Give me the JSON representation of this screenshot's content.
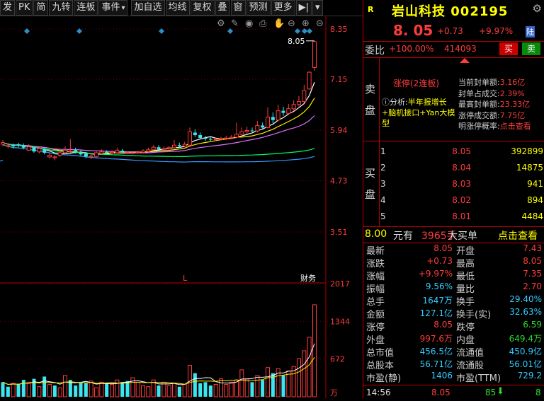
{
  "toolbar": {
    "buttons": [
      "发",
      "PK",
      "简",
      "九转",
      "连板",
      "事件",
      "加自选",
      "均线",
      "复权",
      "叠",
      "窗",
      "预测",
      "更多"
    ],
    "dropdown_button": "事件",
    "icons": [
      "jump-end-icon",
      "dropdown-icon"
    ]
  },
  "chart_tools": [
    "settings-icon",
    "pencil-icon",
    "eye-icon",
    "print-icon",
    "hand-icon",
    "zoom-out-icon",
    "zoom-in-icon",
    "collapse-icon"
  ],
  "price_axis": [
    "8.35",
    "7.15",
    "5.94",
    "4.73",
    "3.51"
  ],
  "volume_axis": [
    "2017",
    "1344",
    "672",
    "万"
  ],
  "last_price_label": "8.05",
  "chart_markers": {
    "low_label": "L",
    "finance_label": "财务"
  },
  "chart_data": {
    "type": "candlestick",
    "title": "",
    "ylim_price": [
      3.51,
      8.35
    ],
    "ylim_volume": [
      0,
      2017
    ],
    "candles": [
      {
        "o": 5.6,
        "c": 5.64,
        "h": 5.7,
        "l": 5.55
      },
      {
        "o": 5.55,
        "c": 5.57,
        "h": 5.63,
        "l": 5.5
      },
      {
        "o": 5.58,
        "c": 5.55,
        "h": 5.62,
        "l": 5.5
      },
      {
        "o": 5.6,
        "c": 5.58,
        "h": 5.64,
        "l": 5.53
      },
      {
        "o": 5.58,
        "c": 5.52,
        "h": 5.62,
        "l": 5.48
      },
      {
        "o": 5.46,
        "c": 5.54,
        "h": 5.6,
        "l": 5.44
      },
      {
        "o": 5.52,
        "c": 5.43,
        "h": 5.56,
        "l": 5.4
      },
      {
        "o": 5.42,
        "c": 5.5,
        "h": 5.54,
        "l": 5.38
      },
      {
        "o": 5.48,
        "c": 5.4,
        "h": 5.52,
        "l": 5.36
      },
      {
        "o": 5.3,
        "c": 5.34,
        "h": 5.4,
        "l": 5.26
      },
      {
        "o": 5.28,
        "c": 5.3,
        "h": 5.34,
        "l": 5.22
      },
      {
        "o": 5.34,
        "c": 5.4,
        "h": 5.5,
        "l": 5.3
      },
      {
        "o": 5.4,
        "c": 5.46,
        "h": 5.55,
        "l": 5.36
      },
      {
        "o": 5.44,
        "c": 5.44,
        "h": 5.72,
        "l": 5.4
      },
      {
        "o": 5.46,
        "c": 5.42,
        "h": 5.52,
        "l": 5.38
      },
      {
        "o": 5.4,
        "c": 5.36,
        "h": 5.46,
        "l": 5.32
      },
      {
        "o": 5.38,
        "c": 5.31,
        "h": 5.42,
        "l": 5.27
      },
      {
        "o": 5.3,
        "c": 5.32,
        "h": 5.4,
        "l": 5.25
      },
      {
        "o": 5.31,
        "c": 5.4,
        "h": 5.45,
        "l": 5.29
      },
      {
        "o": 5.38,
        "c": 5.42,
        "h": 5.48,
        "l": 5.35
      },
      {
        "o": 5.42,
        "c": 5.4,
        "h": 5.46,
        "l": 5.37
      },
      {
        "o": 5.39,
        "c": 5.41,
        "h": 5.46,
        "l": 5.36
      },
      {
        "o": 5.4,
        "c": 5.46,
        "h": 5.52,
        "l": 5.38
      },
      {
        "o": 5.45,
        "c": 5.41,
        "h": 5.49,
        "l": 5.38
      },
      {
        "o": 5.4,
        "c": 5.4,
        "h": 5.43,
        "l": 5.36
      },
      {
        "o": 5.39,
        "c": 5.4,
        "h": 5.44,
        "l": 5.36
      },
      {
        "o": 5.4,
        "c": 5.41,
        "h": 5.45,
        "l": 5.37
      },
      {
        "o": 5.41,
        "c": 5.44,
        "h": 5.48,
        "l": 5.38
      },
      {
        "o": 5.43,
        "c": 5.47,
        "h": 5.52,
        "l": 5.41
      },
      {
        "o": 5.47,
        "c": 5.53,
        "h": 5.58,
        "l": 5.45
      },
      {
        "o": 5.53,
        "c": 5.48,
        "h": 5.58,
        "l": 5.45
      },
      {
        "o": 5.48,
        "c": 5.5,
        "h": 5.55,
        "l": 5.46
      },
      {
        "o": 5.5,
        "c": 5.52,
        "h": 5.56,
        "l": 5.47
      },
      {
        "o": 5.52,
        "c": 5.58,
        "h": 5.7,
        "l": 5.5
      },
      {
        "o": 5.58,
        "c": 5.55,
        "h": 5.64,
        "l": 5.52
      },
      {
        "o": 5.56,
        "c": 5.6,
        "h": 5.66,
        "l": 5.53
      },
      {
        "o": 5.58,
        "c": 5.9,
        "h": 6.0,
        "l": 5.56
      },
      {
        "o": 5.88,
        "c": 5.82,
        "h": 5.96,
        "l": 5.78
      },
      {
        "o": 5.82,
        "c": 5.75,
        "h": 5.88,
        "l": 5.72
      },
      {
        "o": 5.75,
        "c": 5.73,
        "h": 5.8,
        "l": 5.68
      },
      {
        "o": 5.73,
        "c": 5.71,
        "h": 5.78,
        "l": 5.68
      },
      {
        "o": 5.72,
        "c": 5.73,
        "h": 5.76,
        "l": 5.68
      },
      {
        "o": 5.72,
        "c": 5.74,
        "h": 5.78,
        "l": 5.69
      },
      {
        "o": 5.74,
        "c": 5.75,
        "h": 5.8,
        "l": 5.7
      },
      {
        "o": 5.75,
        "c": 5.77,
        "h": 5.82,
        "l": 5.72
      },
      {
        "o": 5.77,
        "c": 5.84,
        "h": 6.12,
        "l": 5.74
      },
      {
        "o": 5.84,
        "c": 5.9,
        "h": 6.0,
        "l": 5.8
      },
      {
        "o": 5.9,
        "c": 5.93,
        "h": 6.02,
        "l": 5.86
      },
      {
        "o": 5.93,
        "c": 5.92,
        "h": 6.0,
        "l": 5.86
      },
      {
        "o": 5.92,
        "c": 6.05,
        "h": 6.16,
        "l": 5.88
      },
      {
        "o": 6.05,
        "c": 6.0,
        "h": 6.12,
        "l": 5.96
      },
      {
        "o": 6.0,
        "c": 6.25,
        "h": 6.48,
        "l": 5.98
      },
      {
        "o": 6.25,
        "c": 6.18,
        "h": 6.36,
        "l": 6.1
      },
      {
        "o": 6.18,
        "c": 6.4,
        "h": 6.55,
        "l": 6.15
      },
      {
        "o": 6.4,
        "c": 6.35,
        "h": 6.5,
        "l": 6.28
      },
      {
        "o": 6.34,
        "c": 6.45,
        "h": 6.56,
        "l": 6.3
      },
      {
        "o": 6.45,
        "c": 6.55,
        "h": 6.65,
        "l": 6.4
      },
      {
        "o": 6.55,
        "c": 6.62,
        "h": 6.75,
        "l": 6.5
      },
      {
        "o": 6.62,
        "c": 6.88,
        "h": 7.02,
        "l": 6.58
      },
      {
        "o": 6.92,
        "c": 7.32,
        "h": 7.34,
        "l": 6.9
      },
      {
        "o": 7.43,
        "c": 8.05,
        "h": 8.05,
        "l": 7.35
      }
    ],
    "volume_up_flags": [
      0,
      0,
      1,
      0,
      0,
      1,
      0,
      1,
      0,
      1,
      0,
      1,
      1,
      0,
      0,
      0,
      0,
      1,
      1,
      1,
      0,
      1,
      1,
      0,
      0,
      1,
      1,
      1,
      1,
      1,
      0,
      1,
      1,
      1,
      0,
      1,
      1,
      0,
      0,
      0,
      0,
      1,
      1,
      1,
      1,
      1,
      1,
      1,
      0,
      1,
      0,
      1,
      0,
      1,
      0,
      1,
      1,
      1,
      1,
      1,
      1
    ],
    "volumes": [
      260,
      180,
      240,
      220,
      300,
      260,
      320,
      180,
      360,
      220,
      200,
      160,
      380,
      300,
      200,
      250,
      240,
      280,
      160,
      260,
      240,
      220,
      300,
      260,
      280,
      340,
      260,
      200,
      180,
      300,
      200,
      260,
      200,
      240,
      180,
      220,
      560,
      420,
      240,
      260,
      200,
      220,
      320,
      220,
      260,
      300,
      480,
      320,
      260,
      380,
      300,
      520,
      420,
      500,
      380,
      460,
      540,
      680,
      820,
      1060,
      1640
    ],
    "ma_lines": [
      {
        "name": "MA5",
        "color": "#ffffff"
      },
      {
        "name": "MA10",
        "color": "#ffee00"
      },
      {
        "name": "MA20",
        "color": "#e070ff"
      },
      {
        "name": "MA60",
        "color": "#00ff66"
      },
      {
        "name": "MA120",
        "color": "#3399ff"
      }
    ]
  },
  "quote": {
    "badge": "R",
    "title": "岩山科技 002195",
    "price": "8. 05",
    "change": "+0.73",
    "pct": "+9.97%",
    "market": "陆",
    "weibi_label": "委比",
    "weibi": "+100.00%",
    "weicha": "414093",
    "buy_btn": "买",
    "sell_btn": "卖"
  },
  "sell_panel": {
    "side_label": [
      "卖",
      "盘"
    ],
    "zt_title": "涨停(2连板)",
    "analysis_q": "ⓘ分析:",
    "analysis": "半年报增长+脑机接口+Yan大模型",
    "stats": [
      {
        "k": "当前封单额:",
        "v": "3.16亿"
      },
      {
        "k": "封单占成交:",
        "v": "2.39%"
      },
      {
        "k": "最高封单额:",
        "v": "23.33亿"
      },
      {
        "k": "涨停成交额:",
        "v": "7.75亿"
      },
      {
        "k": "明涨停概率:",
        "v": "点击查看"
      }
    ]
  },
  "buy_panel": {
    "side_label": [
      "买",
      "盘"
    ],
    "levels": [
      {
        "n": "1",
        "p": "8.05",
        "q": "392899"
      },
      {
        "n": "2",
        "p": "8.04",
        "q": "14875"
      },
      {
        "n": "3",
        "p": "8.03",
        "q": "941"
      },
      {
        "n": "4",
        "p": "8.02",
        "q": "894"
      },
      {
        "n": "5",
        "p": "8.01",
        "q": "4484"
      }
    ]
  },
  "big_buy": {
    "price": "8.00",
    "unit": "元有",
    "qty": "3965手",
    "label": "大买单",
    "link": "点击查看"
  },
  "stats": [
    {
      "k1": "最新",
      "v1": "8.05",
      "c1": "red",
      "k2": "开盘",
      "v2": "7.43",
      "c2": "red"
    },
    {
      "k1": "涨跌",
      "v1": "+0.73",
      "c1": "red",
      "k2": "最高",
      "v2": "8.05",
      "c2": "red"
    },
    {
      "k1": "涨幅",
      "v1": "+9.97%",
      "c1": "red",
      "k2": "最低",
      "v2": "7.35",
      "c2": "red"
    },
    {
      "k1": "振幅",
      "v1": "9.56%",
      "c1": "cyn",
      "k2": "量比",
      "v2": "2.70",
      "c2": "red"
    },
    {
      "k1": "总手",
      "v1": "1647万",
      "c1": "cyn",
      "k2": "换手",
      "v2": "29.40%",
      "c2": "cyn"
    },
    {
      "k1": "金额",
      "v1": "127.1亿",
      "c1": "cyn",
      "k2": "换手(实)",
      "v2": "32.63%",
      "c2": "cyn"
    },
    {
      "k1": "涨停",
      "v1": "8.05",
      "c1": "red",
      "k2": "跌停",
      "v2": "6.59",
      "c2": "grn"
    },
    {
      "k1": "外盘",
      "v1": "997.6万",
      "c1": "red",
      "k2": "内盘",
      "v2": "649.4万",
      "c2": "grn"
    },
    {
      "k1": "总市值",
      "v1": "456.5亿",
      "c1": "cyn",
      "k2": "流通值",
      "v2": "450.9亿",
      "c2": "cyn"
    },
    {
      "k1": "总股本",
      "v1": "56.71亿",
      "c1": "cyn",
      "k2": "流通股",
      "v2": "56.01亿",
      "c2": "cyn"
    },
    {
      "k1": "市盈(静)",
      "v1": "1406",
      "c1": "cyn",
      "k2": "市盈(TTM)",
      "v2": "729.2",
      "c2": "cyn"
    }
  ],
  "tick": {
    "time": "14:56",
    "price": "8.05",
    "qty": "85",
    "arrow": "⬇",
    "count": "8"
  }
}
